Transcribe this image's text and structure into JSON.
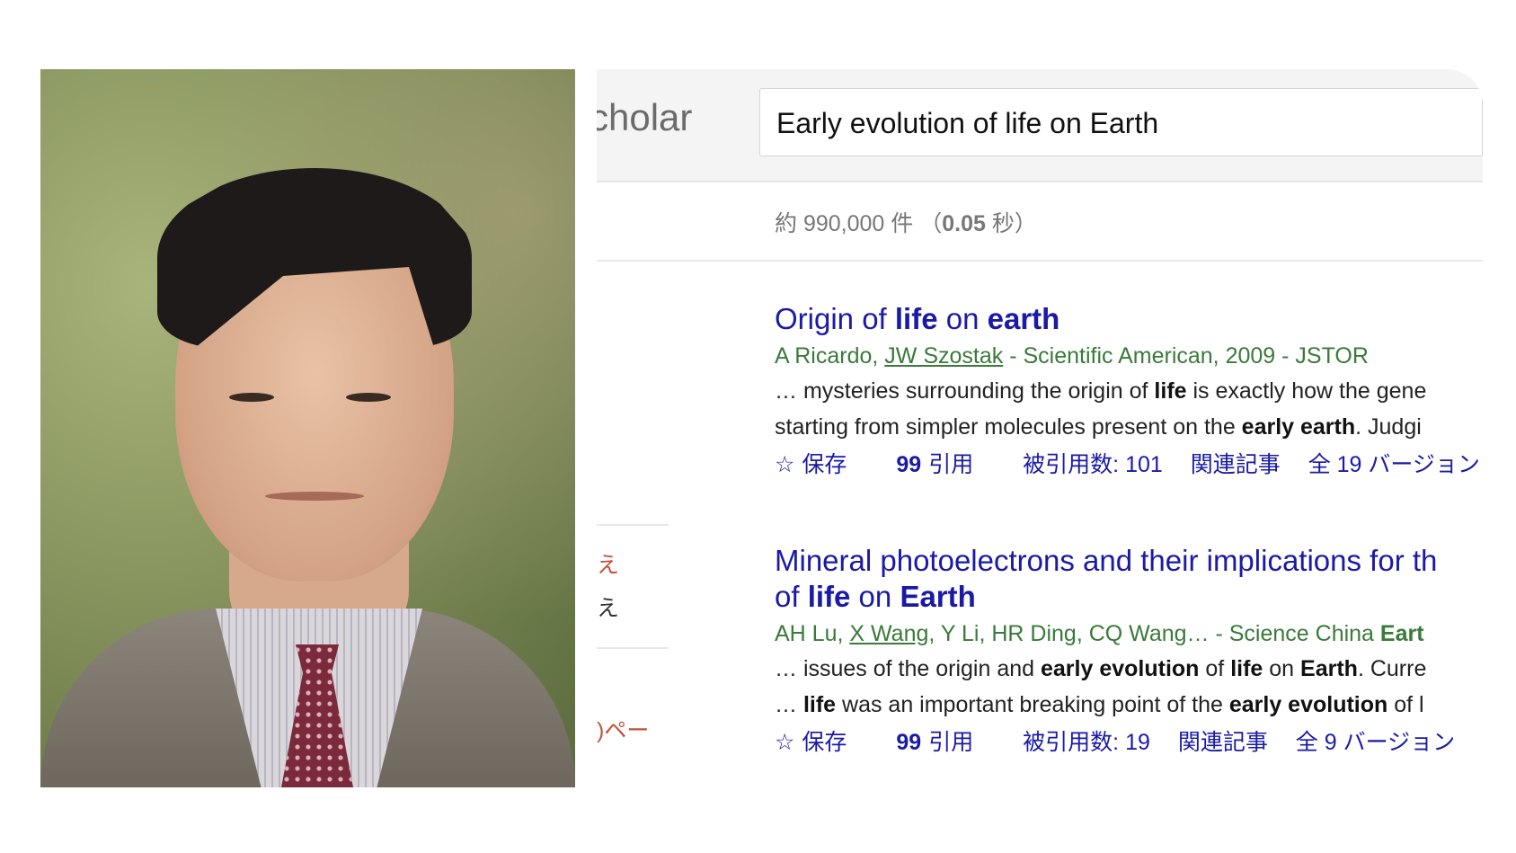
{
  "photo": {
    "description_icon": "portrait-photo"
  },
  "scholar": {
    "logo_text": "cholar",
    "search_value": "Early evolution of life on Earth",
    "result_count_prefix": "約 990,000 件 （",
    "result_time": "0.05",
    "result_count_suffix": " 秒）",
    "sidebar": [
      "え",
      "え",
      ")ペー"
    ],
    "results": [
      {
        "title_parts": [
          "Origin of ",
          "life",
          " on ",
          "earth"
        ],
        "authors_parts": [
          "A Ricardo, ",
          "JW Szostak",
          " - Scientific American, 2009 - JSTOR"
        ],
        "snippet1_parts": [
          "… mysteries surrounding the origin of ",
          "life",
          " is exactly how the gene"
        ],
        "snippet2_parts": [
          "starting from simpler molecules present on the ",
          "early earth",
          ". Judgi"
        ],
        "actions": {
          "save": "保存",
          "cite": "引用",
          "cited_by": "被引用数: 101",
          "related": "関連記事",
          "versions": "全 19 バージョン"
        }
      },
      {
        "title_line1": "Mineral photoelectrons and their implications for th",
        "title_parts": [
          "of ",
          "life",
          " on ",
          "Earth"
        ],
        "authors_parts": [
          "AH Lu, ",
          "X Wang",
          ", Y Li, HR Ding, CQ Wang… - Science China ",
          "Eart"
        ],
        "snippet1_parts": [
          "… issues of the origin and ",
          "early evolution",
          " of ",
          "life",
          " on ",
          "Earth",
          ". Curre"
        ],
        "snippet2_parts": [
          "… ",
          "life",
          " was an important breaking point of the ",
          "early evolution",
          " of l"
        ],
        "actions": {
          "save": "保存",
          "cite": "引用",
          "cited_by": "被引用数: 19",
          "related": "関連記事",
          "versions": "全 9 バージョン"
        }
      }
    ]
  }
}
